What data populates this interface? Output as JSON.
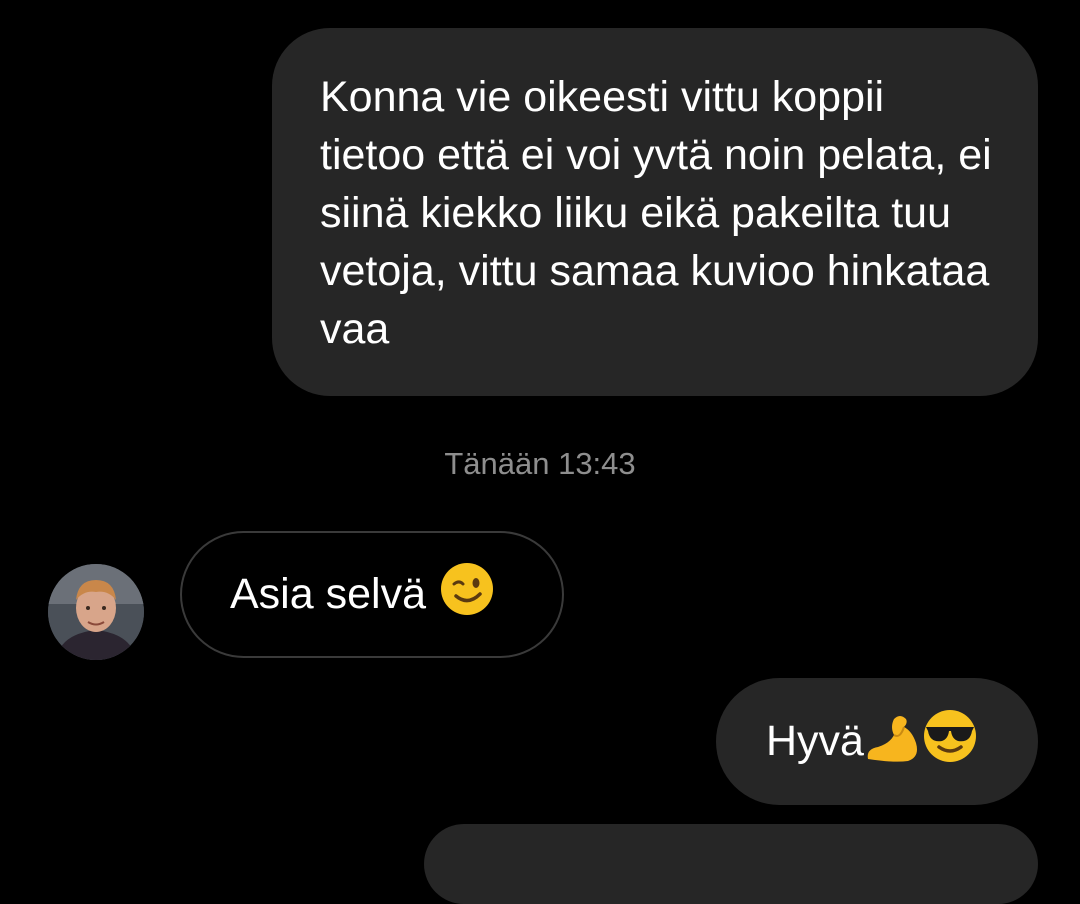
{
  "messages": [
    {
      "direction": "outgoing",
      "text": "Konna vie oikeesti vittu koppii tietoo että ei voi yvtä noin pelata, ei siinä kiekko liiku eikä pakeilta tuu vetoja, vittu samaa kuvioo hinkataa vaa"
    },
    {
      "direction": "incoming",
      "text": "Asia selvä",
      "emoji": "winking-face-emoji"
    },
    {
      "direction": "outgoing",
      "text": "Hyvä",
      "emojis": [
        "flexed-biceps-emoji",
        "smiling-face-with-sunglasses-emoji"
      ]
    }
  ],
  "timestamp": "Tänään 13:43",
  "colors": {
    "background": "#000000",
    "outgoing_bubble": "#262626",
    "incoming_border": "#3a3a3a",
    "timestamp_text": "#8e8e8e"
  }
}
